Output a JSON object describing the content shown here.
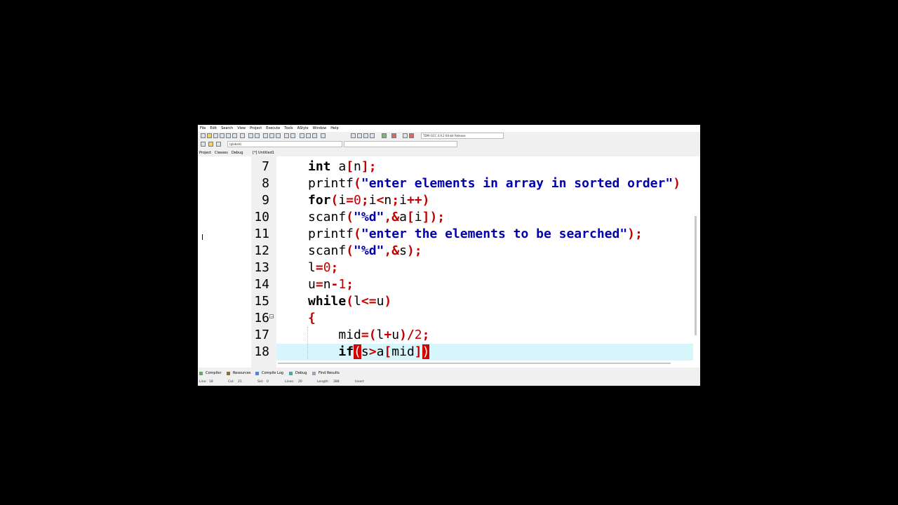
{
  "menu": [
    "File",
    "Edit",
    "Search",
    "View",
    "Project",
    "Execute",
    "Tools",
    "AStyle",
    "Window",
    "Help"
  ],
  "toolbar": {
    "compiler_select": "TDM-GCC 4.9.2 64-bit Release",
    "scope_select": "(globals)"
  },
  "tabs": {
    "project": "Project",
    "classes": "Classes",
    "debug": "Debug",
    "file_tab": "[*] Untitled1"
  },
  "editor": {
    "lines": [
      {
        "num": "7"
      },
      {
        "num": "8"
      },
      {
        "num": "9"
      },
      {
        "num": "10"
      },
      {
        "num": "11"
      },
      {
        "num": "12"
      },
      {
        "num": "13"
      },
      {
        "num": "14"
      },
      {
        "num": "15"
      },
      {
        "num": "16"
      },
      {
        "num": "17"
      },
      {
        "num": "18"
      }
    ]
  },
  "bottom_tabs": [
    "Compiler",
    "Resources",
    "Compile Log",
    "Debug",
    "Find Results"
  ],
  "status": {
    "line_label": "Line:",
    "line_value": "18",
    "col_label": "Col:",
    "col_value": "21",
    "sel_label": "Sel:",
    "sel_value": "0",
    "lines_label": "Lines:",
    "lines_value": "20",
    "length_label": "Length:",
    "length_value": "388",
    "mode": "Insert"
  },
  "colors": {
    "keyword": "#000000",
    "symbol": "#c00000",
    "string": "#0000b0",
    "current_line": "#d7f6fb",
    "bracket_highlight": "#d40000"
  }
}
